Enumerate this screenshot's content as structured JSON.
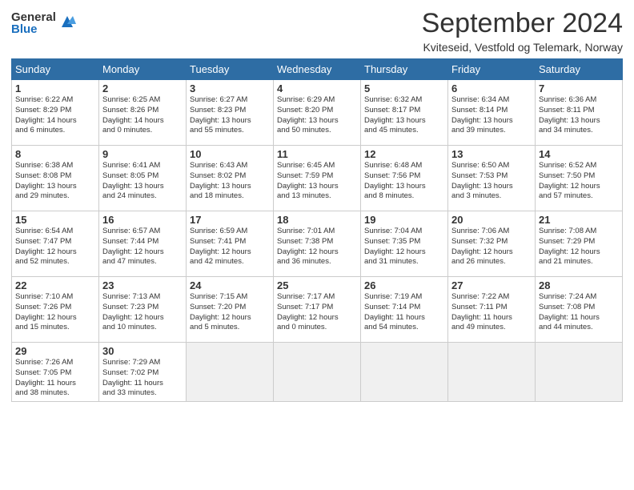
{
  "logo": {
    "general": "General",
    "blue": "Blue"
  },
  "title": "September 2024",
  "location": "Kviteseid, Vestfold og Telemark, Norway",
  "headers": [
    "Sunday",
    "Monday",
    "Tuesday",
    "Wednesday",
    "Thursday",
    "Friday",
    "Saturday"
  ],
  "weeks": [
    [
      {
        "day": "1",
        "lines": [
          "Sunrise: 6:22 AM",
          "Sunset: 8:29 PM",
          "Daylight: 14 hours",
          "and 6 minutes."
        ]
      },
      {
        "day": "2",
        "lines": [
          "Sunrise: 6:25 AM",
          "Sunset: 8:26 PM",
          "Daylight: 14 hours",
          "and 0 minutes."
        ]
      },
      {
        "day": "3",
        "lines": [
          "Sunrise: 6:27 AM",
          "Sunset: 8:23 PM",
          "Daylight: 13 hours",
          "and 55 minutes."
        ]
      },
      {
        "day": "4",
        "lines": [
          "Sunrise: 6:29 AM",
          "Sunset: 8:20 PM",
          "Daylight: 13 hours",
          "and 50 minutes."
        ]
      },
      {
        "day": "5",
        "lines": [
          "Sunrise: 6:32 AM",
          "Sunset: 8:17 PM",
          "Daylight: 13 hours",
          "and 45 minutes."
        ]
      },
      {
        "day": "6",
        "lines": [
          "Sunrise: 6:34 AM",
          "Sunset: 8:14 PM",
          "Daylight: 13 hours",
          "and 39 minutes."
        ]
      },
      {
        "day": "7",
        "lines": [
          "Sunrise: 6:36 AM",
          "Sunset: 8:11 PM",
          "Daylight: 13 hours",
          "and 34 minutes."
        ]
      }
    ],
    [
      {
        "day": "8",
        "lines": [
          "Sunrise: 6:38 AM",
          "Sunset: 8:08 PM",
          "Daylight: 13 hours",
          "and 29 minutes."
        ]
      },
      {
        "day": "9",
        "lines": [
          "Sunrise: 6:41 AM",
          "Sunset: 8:05 PM",
          "Daylight: 13 hours",
          "and 24 minutes."
        ]
      },
      {
        "day": "10",
        "lines": [
          "Sunrise: 6:43 AM",
          "Sunset: 8:02 PM",
          "Daylight: 13 hours",
          "and 18 minutes."
        ]
      },
      {
        "day": "11",
        "lines": [
          "Sunrise: 6:45 AM",
          "Sunset: 7:59 PM",
          "Daylight: 13 hours",
          "and 13 minutes."
        ]
      },
      {
        "day": "12",
        "lines": [
          "Sunrise: 6:48 AM",
          "Sunset: 7:56 PM",
          "Daylight: 13 hours",
          "and 8 minutes."
        ]
      },
      {
        "day": "13",
        "lines": [
          "Sunrise: 6:50 AM",
          "Sunset: 7:53 PM",
          "Daylight: 13 hours",
          "and 3 minutes."
        ]
      },
      {
        "day": "14",
        "lines": [
          "Sunrise: 6:52 AM",
          "Sunset: 7:50 PM",
          "Daylight: 12 hours",
          "and 57 minutes."
        ]
      }
    ],
    [
      {
        "day": "15",
        "lines": [
          "Sunrise: 6:54 AM",
          "Sunset: 7:47 PM",
          "Daylight: 12 hours",
          "and 52 minutes."
        ]
      },
      {
        "day": "16",
        "lines": [
          "Sunrise: 6:57 AM",
          "Sunset: 7:44 PM",
          "Daylight: 12 hours",
          "and 47 minutes."
        ]
      },
      {
        "day": "17",
        "lines": [
          "Sunrise: 6:59 AM",
          "Sunset: 7:41 PM",
          "Daylight: 12 hours",
          "and 42 minutes."
        ]
      },
      {
        "day": "18",
        "lines": [
          "Sunrise: 7:01 AM",
          "Sunset: 7:38 PM",
          "Daylight: 12 hours",
          "and 36 minutes."
        ]
      },
      {
        "day": "19",
        "lines": [
          "Sunrise: 7:04 AM",
          "Sunset: 7:35 PM",
          "Daylight: 12 hours",
          "and 31 minutes."
        ]
      },
      {
        "day": "20",
        "lines": [
          "Sunrise: 7:06 AM",
          "Sunset: 7:32 PM",
          "Daylight: 12 hours",
          "and 26 minutes."
        ]
      },
      {
        "day": "21",
        "lines": [
          "Sunrise: 7:08 AM",
          "Sunset: 7:29 PM",
          "Daylight: 12 hours",
          "and 21 minutes."
        ]
      }
    ],
    [
      {
        "day": "22",
        "lines": [
          "Sunrise: 7:10 AM",
          "Sunset: 7:26 PM",
          "Daylight: 12 hours",
          "and 15 minutes."
        ]
      },
      {
        "day": "23",
        "lines": [
          "Sunrise: 7:13 AM",
          "Sunset: 7:23 PM",
          "Daylight: 12 hours",
          "and 10 minutes."
        ]
      },
      {
        "day": "24",
        "lines": [
          "Sunrise: 7:15 AM",
          "Sunset: 7:20 PM",
          "Daylight: 12 hours",
          "and 5 minutes."
        ]
      },
      {
        "day": "25",
        "lines": [
          "Sunrise: 7:17 AM",
          "Sunset: 7:17 PM",
          "Daylight: 12 hours",
          "and 0 minutes."
        ]
      },
      {
        "day": "26",
        "lines": [
          "Sunrise: 7:19 AM",
          "Sunset: 7:14 PM",
          "Daylight: 11 hours",
          "and 54 minutes."
        ]
      },
      {
        "day": "27",
        "lines": [
          "Sunrise: 7:22 AM",
          "Sunset: 7:11 PM",
          "Daylight: 11 hours",
          "and 49 minutes."
        ]
      },
      {
        "day": "28",
        "lines": [
          "Sunrise: 7:24 AM",
          "Sunset: 7:08 PM",
          "Daylight: 11 hours",
          "and 44 minutes."
        ]
      }
    ],
    [
      {
        "day": "29",
        "lines": [
          "Sunrise: 7:26 AM",
          "Sunset: 7:05 PM",
          "Daylight: 11 hours",
          "and 38 minutes."
        ]
      },
      {
        "day": "30",
        "lines": [
          "Sunrise: 7:29 AM",
          "Sunset: 7:02 PM",
          "Daylight: 11 hours",
          "and 33 minutes."
        ]
      },
      null,
      null,
      null,
      null,
      null
    ]
  ]
}
